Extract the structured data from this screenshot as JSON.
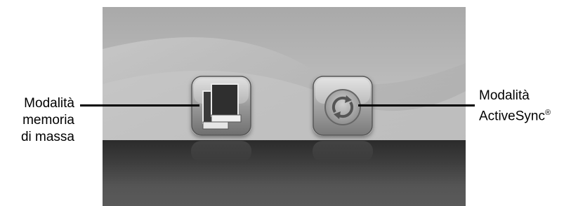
{
  "buttons": {
    "mass_storage": {
      "icon": "mass-storage-icon"
    },
    "activesync": {
      "icon": "sync-icon"
    }
  },
  "callouts": {
    "mass_storage": {
      "line1": "Modalità",
      "line2": "memoria",
      "line3": "di massa"
    },
    "activesync": {
      "line1": "Modalità",
      "line2": "ActiveSync",
      "mark": "®"
    }
  },
  "colors": {
    "screen_background": "#bcbcbc",
    "floor": "#3e3e3e",
    "leader_line": "#000000"
  }
}
